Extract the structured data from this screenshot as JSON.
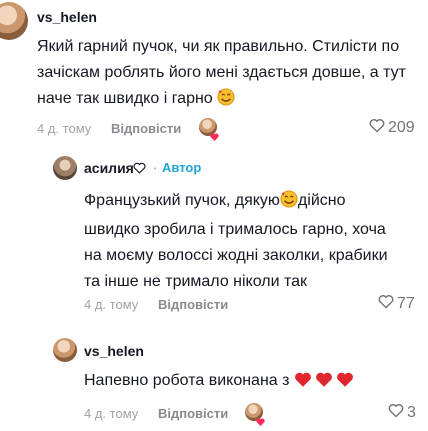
{
  "comments": [
    {
      "username": "vs_helen",
      "text_line1": "Який гарний пучок, чи як правильно. Стилісти по",
      "text_line2": "зачіскам роблять його мені здається довше, а тут",
      "text_line3": "наче так швидко і гарно",
      "time": "4 д. тому",
      "reply_label": "Відповісти",
      "likes": "209"
    },
    {
      "username": "асилия",
      "author_badge": "Автор",
      "text_line1a": "Французький пучок, дякую",
      "text_line1b": "дійсно",
      "text_line2": "швидко зробила і трималось гарно, хоча",
      "text_line3": "на моєму волоссі жодні заколки, крабики",
      "text_line4": "та інше не тримало ніколи так",
      "time": "4 д. тому",
      "reply_label": "Відповісти",
      "likes": "77"
    },
    {
      "username": "vs_helen",
      "text": "Напевно робота виконана з",
      "time": "4 д. тому",
      "reply_label": "Відповісти",
      "likes": "3"
    }
  ],
  "colors": {
    "text": "#161823",
    "meta": "#a1a2a7",
    "author_badge": "#20a4d8",
    "heart_red": "#e0262f"
  }
}
